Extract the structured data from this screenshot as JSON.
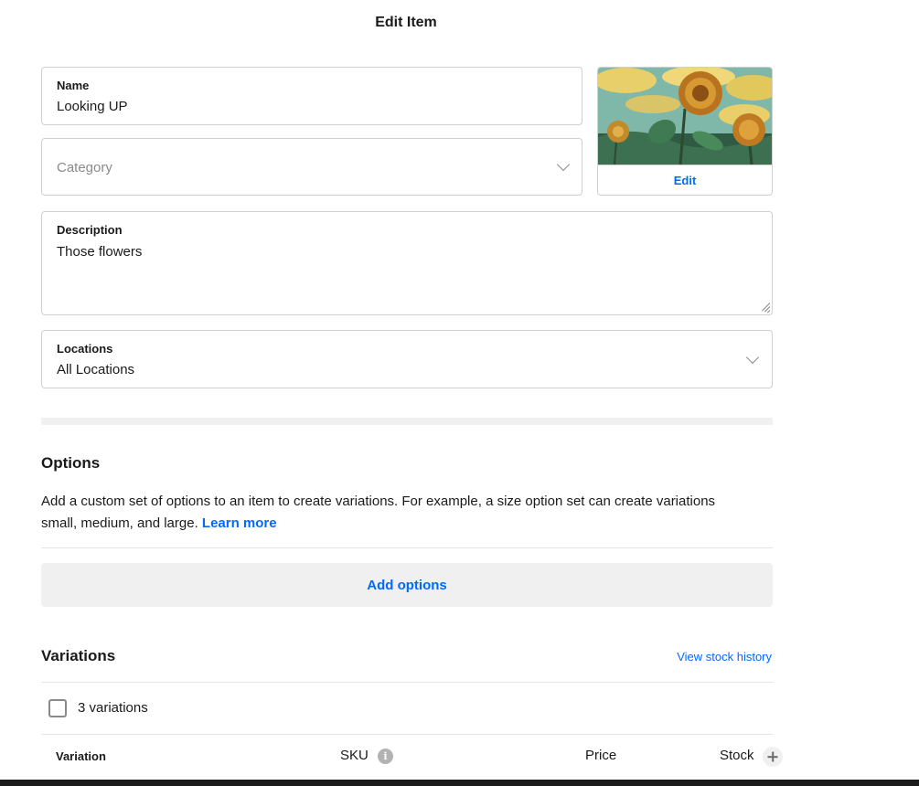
{
  "page": {
    "title": "Edit Item"
  },
  "form": {
    "name": {
      "label": "Name",
      "value": "Looking UP"
    },
    "category": {
      "placeholder": "Category"
    },
    "description": {
      "label": "Description",
      "value": "Those flowers"
    },
    "locations": {
      "label": "Locations",
      "value": "All Locations"
    }
  },
  "image_card": {
    "edit_label": "Edit"
  },
  "options": {
    "title": "Options",
    "description": "Add a custom set of options to an item to create variations. For example, a size option set can create variations small, medium, and large.",
    "learn_more": "Learn more",
    "add_button": "Add options"
  },
  "variations": {
    "title": "Variations",
    "stock_history_link": "View stock history",
    "count_label": "3 variations",
    "columns": {
      "variation": "Variation",
      "sku": "SKU",
      "price": "Price",
      "stock": "Stock"
    }
  },
  "icons": [
    "chevron-down-icon",
    "resize-handle-icon",
    "info-icon",
    "plus-icon",
    "checkbox-icon"
  ],
  "colors": {
    "accent": "#006aff",
    "border": "#d0d0d0",
    "muted_bg": "#f0f0f0"
  }
}
